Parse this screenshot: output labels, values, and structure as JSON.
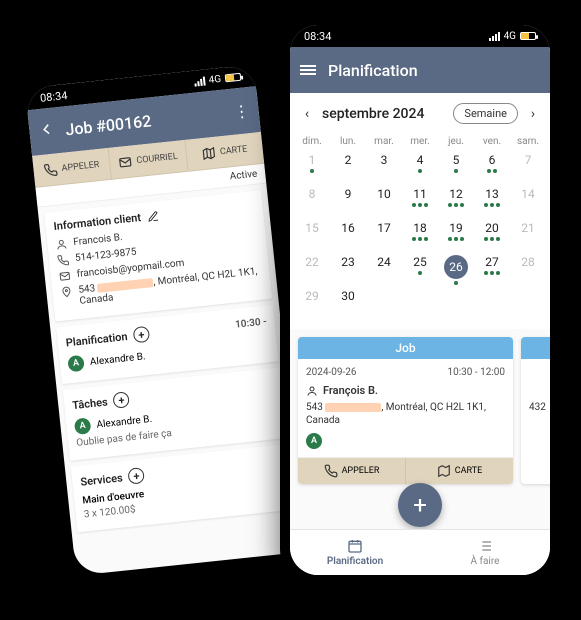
{
  "phone1": {
    "status_time": "08:34",
    "net_label": "4G",
    "title": "Job #00162",
    "tabs": {
      "call": "APPELER",
      "mail": "COURRIEL",
      "map": "CARTE"
    },
    "job_status": "Active",
    "client_info_heading": "Information client",
    "client": {
      "name": "Francois B.",
      "phone": "514-123-9875",
      "email": "francoisb@yopmail.com",
      "address_prefix": "543",
      "address_suffix": ", Montréal, QC H2L 1K1, Canada"
    },
    "planning": {
      "heading": "Planification",
      "time_fragment": "10:30 -",
      "assignee_initial": "A",
      "assignee_name": "Alexandre B."
    },
    "tasks": {
      "heading": "Tâches",
      "assignee_initial": "A",
      "assignee_name": "Alexandre B.",
      "note": "Oublie pas de faire ça"
    },
    "services": {
      "heading": "Services",
      "item_name": "Main d'oeuvre",
      "item_qty": "3 x 120.00$"
    }
  },
  "phone2": {
    "status_time": "08:34",
    "net_label": "4G",
    "title": "Planification",
    "calendar": {
      "month_label": "septembre 2024",
      "view_label": "Semaine",
      "dow": [
        "dim.",
        "lun.",
        "mar.",
        "mer.",
        "jeu.",
        "ven.",
        "sam."
      ],
      "weeks": [
        [
          {
            "n": 1,
            "mute": true,
            "dots": 1
          },
          {
            "n": 2,
            "dots": 0
          },
          {
            "n": 3,
            "dots": 0
          },
          {
            "n": 4,
            "dots": 1
          },
          {
            "n": 5,
            "dots": 1
          },
          {
            "n": 6,
            "dots": 2
          },
          {
            "n": 7,
            "mute": true,
            "dots": 0
          }
        ],
        [
          {
            "n": 8,
            "mute": true,
            "dots": 0
          },
          {
            "n": 9,
            "dots": 0
          },
          {
            "n": 10,
            "dots": 0
          },
          {
            "n": 11,
            "dots": 3
          },
          {
            "n": 12,
            "dots": 3
          },
          {
            "n": 13,
            "dots": 3
          },
          {
            "n": 14,
            "mute": true,
            "dots": 0
          }
        ],
        [
          {
            "n": 15,
            "mute": true,
            "dots": 0
          },
          {
            "n": 16,
            "dots": 0
          },
          {
            "n": 17,
            "dots": 0
          },
          {
            "n": 18,
            "dots": 3
          },
          {
            "n": 19,
            "dots": 3
          },
          {
            "n": 20,
            "dots": 3
          },
          {
            "n": 21,
            "mute": true,
            "dots": 0
          }
        ],
        [
          {
            "n": 22,
            "mute": true,
            "dots": 0
          },
          {
            "n": 23,
            "dots": 0
          },
          {
            "n": 24,
            "dots": 0
          },
          {
            "n": 25,
            "dots": 1
          },
          {
            "n": 26,
            "dots": 1,
            "selected": true
          },
          {
            "n": 27,
            "dots": 3
          },
          {
            "n": 28,
            "mute": true,
            "dots": 0
          }
        ],
        [
          {
            "n": 29,
            "mute": true,
            "dots": 0
          },
          {
            "n": 30,
            "dots": 0
          }
        ]
      ]
    },
    "jobcard": {
      "head": "Job",
      "date": "2024-09-26",
      "time": "10:30 - 12:00",
      "name": "François B.",
      "addr_prefix": "543",
      "addr_suffix": ", Montréal, QC H2L 1K1, Canada",
      "assignee_initial": "A",
      "action_call": "APPELER",
      "action_map": "CARTE"
    },
    "jobcard2_addr_fragment": "432",
    "bottomnav": {
      "planning": "Planification",
      "todo": "À faire"
    }
  }
}
